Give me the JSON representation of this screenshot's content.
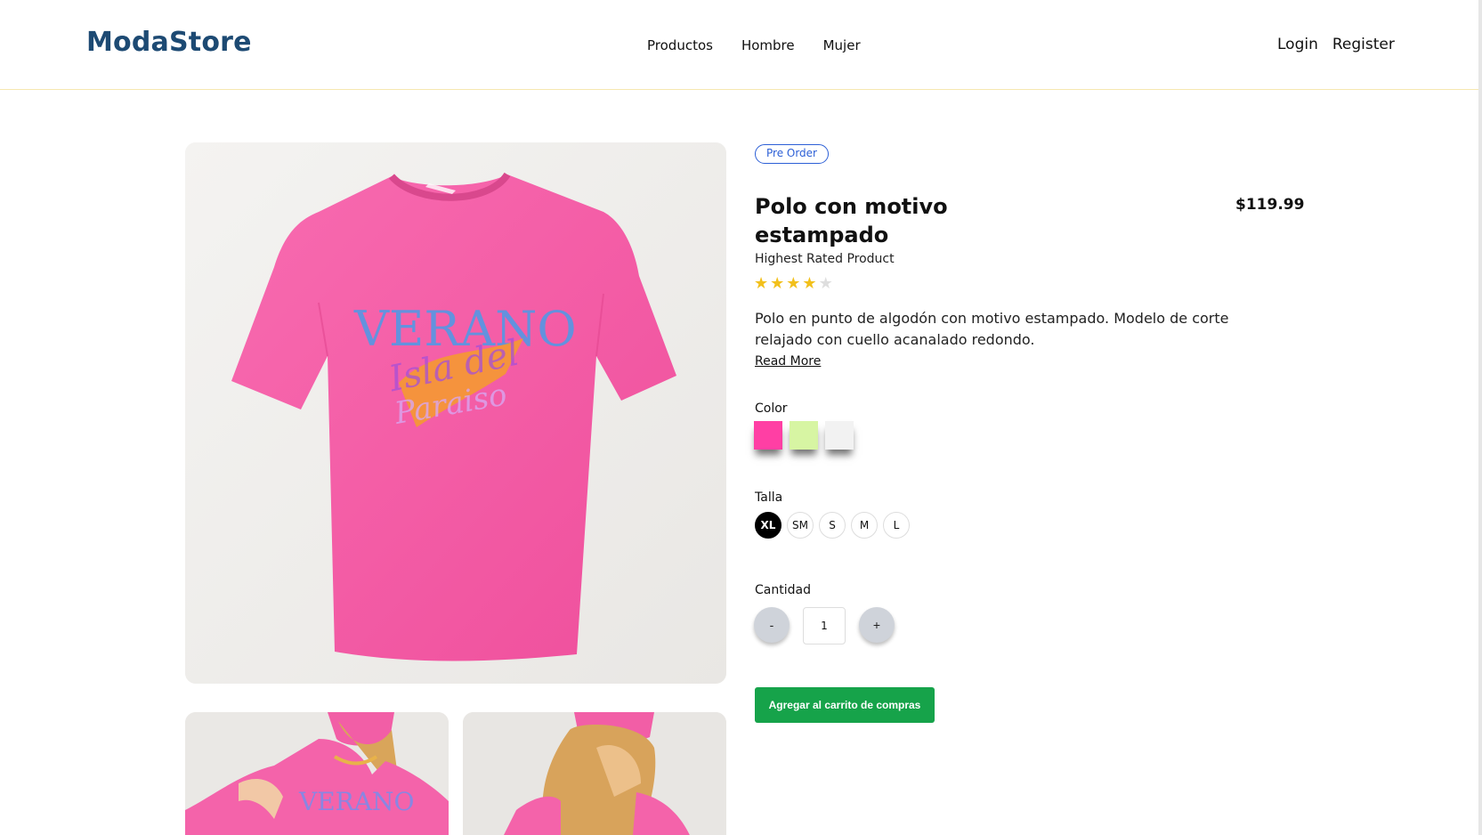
{
  "header": {
    "brand": "ModaStore",
    "nav": [
      "Productos",
      "Hombre",
      "Mujer"
    ],
    "auth": {
      "login": "Login",
      "register": "Register"
    }
  },
  "gallery": {
    "main_image": "pink-tshirt-image",
    "main_print_line1": "VERANO",
    "main_print_line2": "Isla del",
    "main_print_line3": "Paraiso",
    "thumbnails": [
      "model-front-image",
      "model-back-image"
    ],
    "thumb_print": "VERANO"
  },
  "product": {
    "badge": "Pre Order",
    "title": "Polo con motivo estampado",
    "price": "$119.99",
    "subtitle": "Highest Rated Product",
    "rating": 4,
    "rating_max": 5,
    "description": "Polo en punto de algodón con motivo estampado. Modelo de corte relajado con cuello acanalado redondo.",
    "read_more": "Read More",
    "color_label": "Color",
    "colors": [
      "#ff3fa4",
      "#d7f5a3",
      "#f2f2f2"
    ],
    "size_label": "Talla",
    "sizes": [
      "XL",
      "SM",
      "S",
      "M",
      "L"
    ],
    "selected_size": "XL",
    "qty_label": "Cantidad",
    "qty_minus": "-",
    "qty_plus": "+",
    "qty_value": "1",
    "add_to_cart": "Agregar al carrito de compras"
  },
  "colors": {
    "brand": "#1d4a73",
    "badge": "#2c5fd6",
    "cart_button": "#16a34a",
    "star": "#f2c01b",
    "shirt": "#f45fa6"
  }
}
